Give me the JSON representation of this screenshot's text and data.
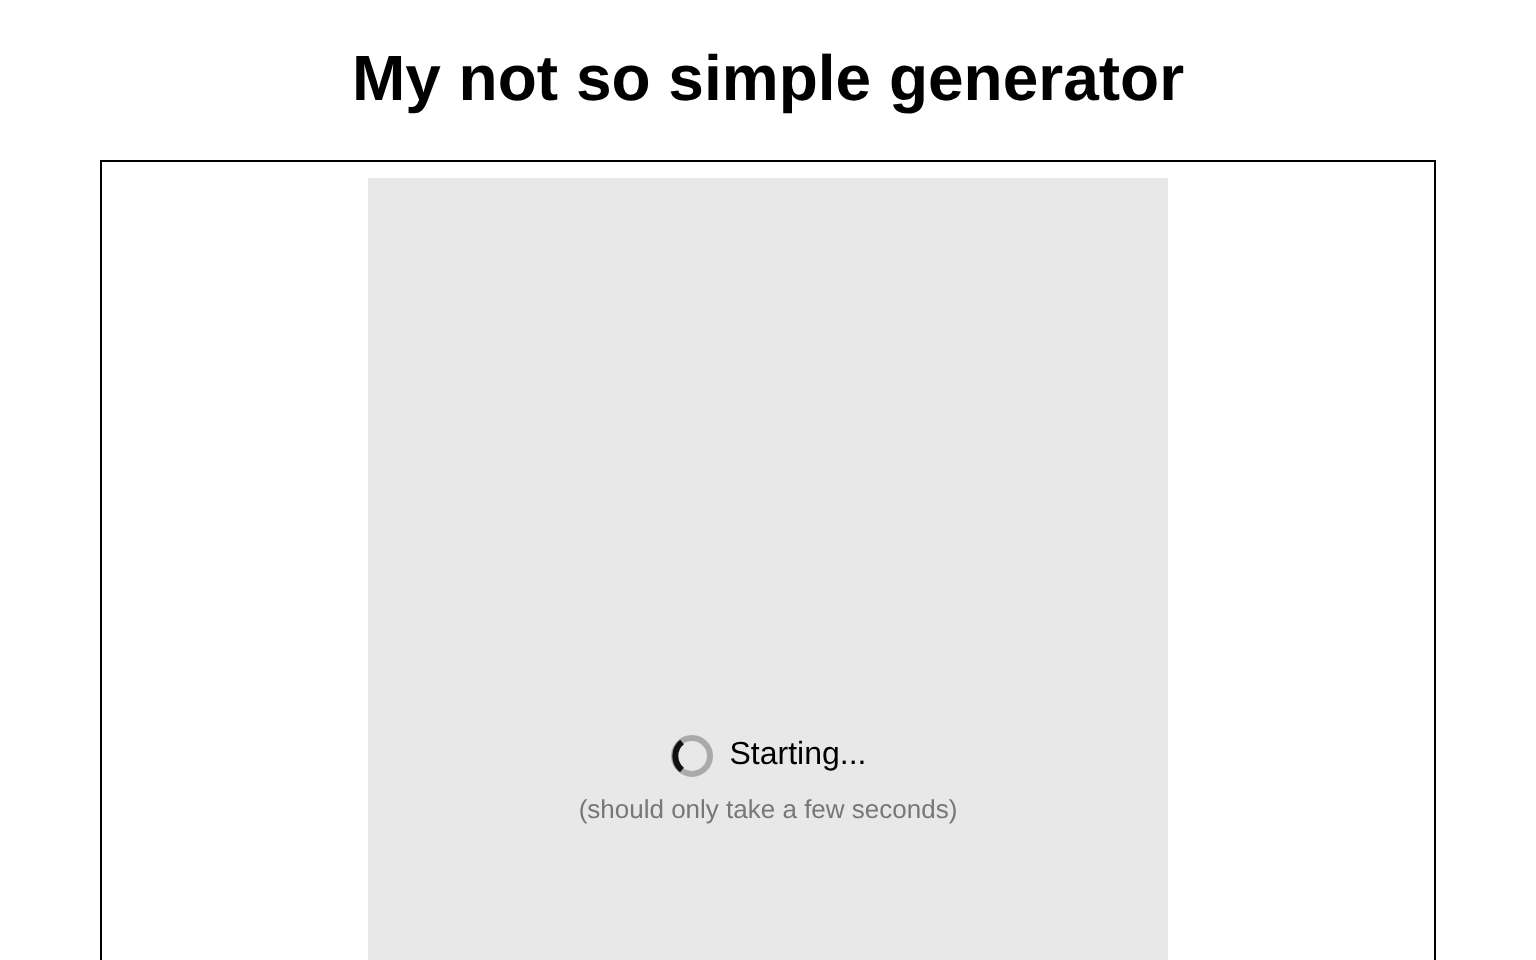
{
  "title": "My not so simple generator",
  "status": {
    "label": "Starting...",
    "note": "(should only take a few seconds)"
  }
}
